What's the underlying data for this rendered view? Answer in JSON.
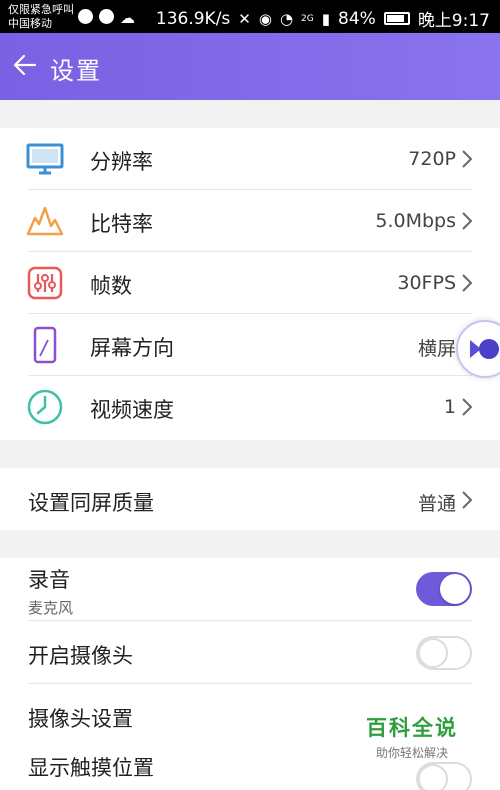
{
  "status_bar": {
    "carrier_line1": "仅限紧急呼叫",
    "carrier_line2": "中国移动",
    "speed": "136.9K/s",
    "network": "2G",
    "battery": "84%",
    "time": "晚上9:17"
  },
  "header": {
    "title": "设置",
    "back_icon": "arrow-left-icon"
  },
  "video_settings": [
    {
      "label": "分辨率",
      "value": "720P",
      "icon": "monitor-icon",
      "color": "#3d8fd8"
    },
    {
      "label": "比特率",
      "value": "5.0Mbps",
      "icon": "waveform-icon",
      "color": "#f0a14a"
    },
    {
      "label": "帧数",
      "value": "30FPS",
      "icon": "sliders-icon",
      "color": "#e85a5a"
    },
    {
      "label": "屏幕方向",
      "value": "横屏",
      "icon": "phone-icon",
      "color": "#8b4fd0"
    },
    {
      "label": "视频速度",
      "value": "1",
      "icon": "clock-icon",
      "color": "#3fc1a8"
    }
  ],
  "quality": {
    "label": "设置同屏质量",
    "value": "普通"
  },
  "audio": {
    "record_label": "录音",
    "record_sub": "麦克风",
    "record_on": true,
    "camera_label": "开启摄像头",
    "camera_on": false,
    "camera_settings_label": "摄像头设置",
    "touch_label": "显示触摸位置",
    "touch_on": false
  },
  "watermark": {
    "main": "百科全说",
    "sub": "助你轻松解决"
  },
  "colors": {
    "accent": "#7a60e3",
    "toggle_on": "#6e5bd9"
  }
}
